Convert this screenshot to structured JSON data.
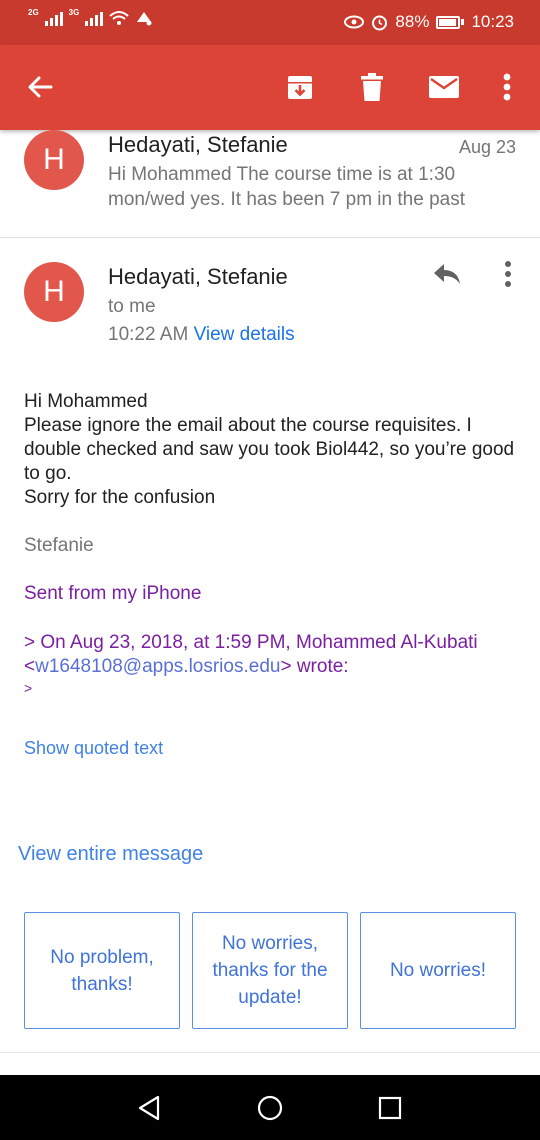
{
  "status_bar": {
    "network_1": "2G",
    "network_2": "3G",
    "battery": "88%",
    "time": "10:23"
  },
  "app_bar": {
    "icons": [
      "back-arrow-icon",
      "archive-icon",
      "delete-icon",
      "mark-unread-icon",
      "more-vert-icon"
    ]
  },
  "collapsed_message": {
    "avatar_letter": "H",
    "sender": "Hedayati, Stefanie",
    "date": "Aug 23",
    "snippet": "Hi Mohammed The course time is at 1:30 mon/wed yes. It has been 7 pm in the past"
  },
  "message": {
    "avatar_letter": "H",
    "sender": "Hedayati, Stefanie",
    "recipient": "to me",
    "time": "10:22 AM",
    "view_details": "View details",
    "body_lines": [
      "Hi Mohammed",
      "Please ignore the email about the course requisites. I double checked and saw you took Biol442, so you’re good to go.",
      "Sorry for the confusion"
    ],
    "signature": "Stefanie",
    "sent_from": "Sent from my iPhone",
    "quote_header": "> On Aug 23, 2018, at 1:59 PM, Mohammed Al-Kubati",
    "quote_email_open": "<",
    "quote_email": "w1648108@apps.losrios.edu",
    "quote_email_close": "> wrote:",
    "quote_marker": ">",
    "show_quoted": "Show quoted text",
    "view_entire": "View entire message"
  },
  "smart_replies": [
    "No problem, thanks!",
    "No worries, thanks for the update!",
    "No worries!"
  ],
  "colors": {
    "status_bar": "#c8392e",
    "app_bar": "#db4437",
    "avatar": "#e2574c",
    "link": "#1a73e8",
    "quote": "#7b1fa2"
  }
}
